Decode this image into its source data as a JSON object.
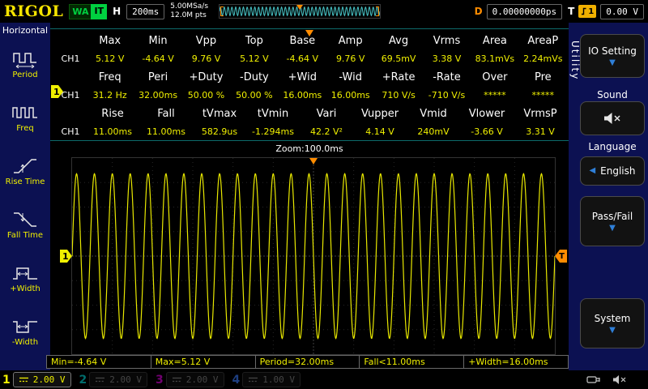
{
  "colors": {
    "ch1": "#f0f000",
    "ch2": "#00d8d8",
    "ch3": "#e000e0",
    "ch4": "#3b7cff",
    "trigger_orange": "#ff8c00",
    "accent_blue": "#2f7fd8",
    "status_green": "#00d040",
    "value_yellow": "#f0f000"
  },
  "top_bar": {
    "logo": "RIGOL",
    "status_left": "WA",
    "status_right": "IT",
    "h_label": "H",
    "timebase": "200ms",
    "sample_rate": "5.00MSa/s",
    "memory_depth": "12.0M pts",
    "d_label": "D",
    "delay": "0.00000000ps",
    "t_label": "T",
    "trigger_source": "1",
    "trigger_level": "0.00 V"
  },
  "left_menu": {
    "title": "Horizontal",
    "items": [
      {
        "label": "Period",
        "icon": "period-icon"
      },
      {
        "label": "Freq",
        "icon": "freq-icon"
      },
      {
        "label": "Rise Time",
        "icon": "rise-time-icon"
      },
      {
        "label": "Fall Time",
        "icon": "fall-time-icon"
      },
      {
        "label": "+Width",
        "icon": "plus-width-icon"
      },
      {
        "label": "-Width",
        "icon": "minus-width-icon"
      }
    ]
  },
  "measure_table": {
    "groups": [
      {
        "headers": [
          "Max",
          "Min",
          "Vpp",
          "Top",
          "Base",
          "Amp",
          "Avg",
          "Vrms",
          "Area",
          "AreaP"
        ],
        "channel": "CH1",
        "values": [
          "5.12 V",
          "-4.64 V",
          "9.76 V",
          "5.12 V",
          "-4.64 V",
          "9.76 V",
          "69.5mV",
          "3.38 V",
          "83.1mVs",
          "2.24mVs"
        ]
      },
      {
        "headers": [
          "Freq",
          "Peri",
          "+Duty",
          "-Duty",
          "+Wid",
          "-Wid",
          "+Rate",
          "-Rate",
          "Over",
          "Pre"
        ],
        "channel": "CH1",
        "values": [
          "31.2 Hz",
          "32.00ms",
          "50.00 %",
          "50.00 %",
          "16.00ms",
          "16.00ms",
          "710 V/s",
          "-710 V/s",
          "*****",
          "*****"
        ]
      },
      {
        "headers": [
          "Rise",
          "Fall",
          "tVmax",
          "tVmin",
          "Vari",
          "Vupper",
          "Vmid",
          "Vlower",
          "VrmsP"
        ],
        "channel": "CH1",
        "values": [
          "11.00ms",
          "11.00ms",
          "582.9us",
          "-1.294ms",
          "42.2 V²",
          "4.14 V",
          "240mV",
          "-3.66 V",
          "3.31 V"
        ]
      }
    ]
  },
  "zoom_label": "Zoom:100.0ms",
  "waveform": {
    "type": "sine",
    "cycles": 27,
    "amplitude_frac": 0.42,
    "color": "#e8e800"
  },
  "preview_wave": {
    "type": "sine",
    "cycles": 42,
    "amplitude_frac": 0.33,
    "color": "#49c6c8"
  },
  "readouts": [
    "Min=-4.64 V",
    "Max=5.12 V",
    "Period=32.00ms",
    "Fall<11.00ms",
    "+Width=16.00ms"
  ],
  "channel_bar": [
    {
      "num": "1",
      "scale": "2.00 V",
      "active": true
    },
    {
      "num": "2",
      "scale": "2.00 V",
      "active": false
    },
    {
      "num": "3",
      "scale": "2.00 V",
      "active": false
    },
    {
      "num": "4",
      "scale": "1.00 V",
      "active": false
    }
  ],
  "right_menu": {
    "tab": "Utility",
    "io_setting": "IO Setting",
    "sound": "Sound",
    "language_label": "Language",
    "language_value": "English",
    "pass_fail": "Pass/Fail",
    "system": "System"
  },
  "markers": {
    "ch1_tag": "1",
    "trigger_tag": "T"
  }
}
